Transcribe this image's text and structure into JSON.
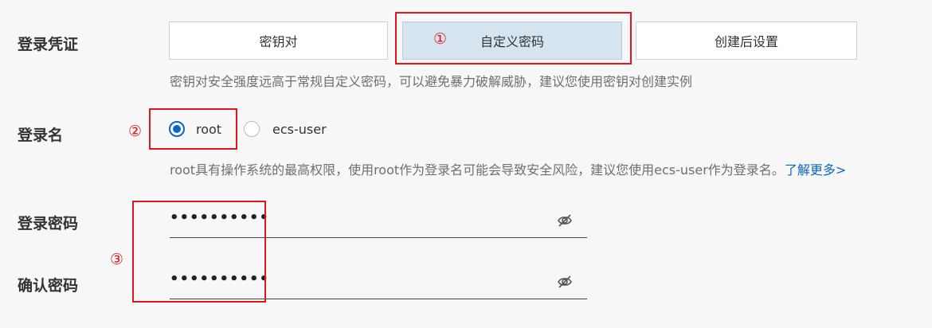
{
  "login_credential": {
    "label": "登录凭证",
    "options": [
      "密钥对",
      "自定义密码",
      "创建后设置"
    ],
    "selected": "自定义密码",
    "hint": "密钥对安全强度远高于常规自定义密码，可以避免暴力破解威胁，建议您使用密钥对创建实例"
  },
  "login_name": {
    "label": "登录名",
    "options": [
      {
        "label": "root",
        "checked": true
      },
      {
        "label": "ecs-user",
        "checked": false
      }
    ],
    "hint": "root具有操作系统的最高权限，使用root作为登录名可能会导致安全风险，建议您使用ecs-user作为登录名。",
    "link": "了解更多>"
  },
  "login_password": {
    "label": "登录密码",
    "value": "••••••••••"
  },
  "confirm_password": {
    "label": "确认密码",
    "value": "••••••••••"
  },
  "annotations": [
    "①",
    "②",
    "③"
  ],
  "icons": {
    "password_visibility": "eye-off-icon"
  },
  "colors": {
    "accent": "#0a66c2",
    "annotation": "#e0161a",
    "selected_bg": "#d6e4f0"
  }
}
